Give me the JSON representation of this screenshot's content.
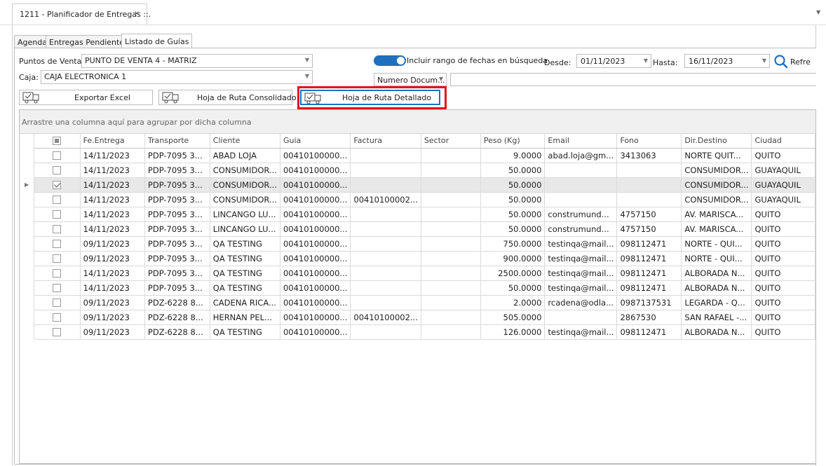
{
  "document_tab": {
    "title": "1211 - Planificador de Entregas ::.",
    "close": "×"
  },
  "tabs": [
    "Agenda",
    "Entregas Pendientes",
    "Listado de Guías"
  ],
  "filters": {
    "puntos_label": "Puntos de Venta:",
    "puntos_value": "PUNTO DE VENTA 4 - MATRIZ",
    "caja_label": "Caja:",
    "caja_value": "CAJA ELECTRONICA 1",
    "toggle_label": "Incluir rango de fechas en búsqueda",
    "toggle_on": true,
    "desde_label": "Desde:",
    "desde_value": "01/11/2023",
    "hasta_label": "Hasta:",
    "hasta_value": "16/11/2023",
    "search_field_value": "Numero Docum...",
    "search_input_value": "",
    "refresh_label": "Refre"
  },
  "toolbar": {
    "export_excel": "Exportar Excel",
    "hoja_consolidado": "Hoja de Ruta Consolidado",
    "hoja_detallado": "Hoja de Ruta Detallado"
  },
  "grid": {
    "group_hint": "Arrastre una columna aquí para agrupar por dicha columna",
    "columns": [
      "Fe.Entrega",
      "Transporte",
      "Cliente",
      "Guia",
      "Factura",
      "Sector",
      "Peso (Kg)",
      "Email",
      "Fono",
      "Dir.Destino",
      "Ciudad"
    ],
    "rows": [
      {
        "checked": false,
        "selected": false,
        "cells": [
          "14/11/2023",
          "PDP-7095 3...",
          "ABAD LOJA",
          "00410100000...",
          "",
          "",
          "9.0000",
          "abad.loja@gm...",
          "3413063",
          "NORTE QUIT...",
          "QUITO"
        ]
      },
      {
        "checked": false,
        "selected": false,
        "cells": [
          "14/11/2023",
          "PDP-7095 3...",
          "CONSUMIDOR...",
          "00410100000...",
          "",
          "",
          "50.0000",
          "",
          "",
          "CONSUMIDOR...",
          "GUAYAQUIL"
        ]
      },
      {
        "checked": true,
        "selected": true,
        "cells": [
          "14/11/2023",
          "PDP-7095 3...",
          "CONSUMIDOR...",
          "00410100000...",
          "",
          "",
          "50.0000",
          "",
          "",
          "CONSUMIDOR...",
          "GUAYAQUIL"
        ]
      },
      {
        "checked": false,
        "selected": false,
        "cells": [
          "14/11/2023",
          "PDP-7095 3...",
          "CONSUMIDOR...",
          "00410100000...",
          "00410100002...",
          "",
          "50.0000",
          "",
          "",
          "CONSUMIDOR...",
          "GUAYAQUIL"
        ]
      },
      {
        "checked": false,
        "selected": false,
        "cells": [
          "14/11/2023",
          "PDP-7095 3...",
          "LINCANGO LU...",
          "00410100000...",
          "",
          "",
          "50.0000",
          "construmund...",
          "4757150",
          "AV. MARISCA...",
          "QUITO"
        ]
      },
      {
        "checked": false,
        "selected": false,
        "cells": [
          "14/11/2023",
          "PDP-7095 3...",
          "LINCANGO LU...",
          "00410100000...",
          "",
          "",
          "50.0000",
          "construmund...",
          "4757150",
          "AV. MARISCA...",
          "QUITO"
        ]
      },
      {
        "checked": false,
        "selected": false,
        "cells": [
          "09/11/2023",
          "PDP-7095 3...",
          "QA TESTING",
          "00410100000...",
          "",
          "",
          "750.0000",
          "testinqa@mail...",
          "098112471",
          "NORTE - QUI...",
          "QUITO"
        ]
      },
      {
        "checked": false,
        "selected": false,
        "cells": [
          "09/11/2023",
          "PDP-7095 3...",
          "QA TESTING",
          "00410100000...",
          "",
          "",
          "900.0000",
          "testinqa@mail...",
          "098112471",
          "NORTE - QUI...",
          "QUITO"
        ]
      },
      {
        "checked": false,
        "selected": false,
        "cells": [
          "14/11/2023",
          "PDP-7095 3...",
          "QA TESTING",
          "00410100000...",
          "",
          "",
          "2500.0000",
          "testinqa@mail...",
          "098112471",
          "ALBORADA N...",
          "QUITO"
        ]
      },
      {
        "checked": false,
        "selected": false,
        "cells": [
          "14/11/2023",
          "PDP-7095 3...",
          "QA TESTING",
          "00410100000...",
          "",
          "",
          "50.0000",
          "testinqa@mail...",
          "098112471",
          "ALBORADA N...",
          "QUITO"
        ]
      },
      {
        "checked": false,
        "selected": false,
        "cells": [
          "09/11/2023",
          "PDZ-6228 8...",
          "CADENA RICA...",
          "00410100000...",
          "",
          "",
          "2.0000",
          "rcadena@odla...",
          "0987137531",
          "LEGARDA - Q...",
          "QUITO"
        ]
      },
      {
        "checked": false,
        "selected": false,
        "cells": [
          "09/11/2023",
          "PDZ-6228 8...",
          "HERNAN PEL...",
          "00410100000...",
          "00410100002...",
          "",
          "505.0000",
          "",
          "2867530",
          "SAN RAFAEL -...",
          "QUITO"
        ]
      },
      {
        "checked": false,
        "selected": false,
        "cells": [
          "09/11/2023",
          "PDZ-6228 8...",
          "QA TESTING",
          "00410100000...",
          "",
          "",
          "126.0000",
          "testinqa@mail...",
          "098112471",
          "ALBORADA N...",
          "QUITO"
        ]
      }
    ]
  },
  "colors": {
    "accent": "#1e6fc0",
    "highlight": "#e3131c",
    "selected_row": "#e8e8e8"
  },
  "icons": {
    "truck": "delivery-truck-icon",
    "search": "search-icon",
    "close": "close-icon"
  }
}
